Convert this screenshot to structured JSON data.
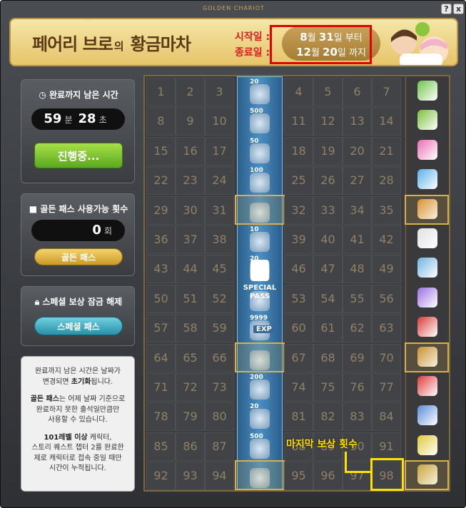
{
  "window": {
    "title": "GOLDEN CHARIOT",
    "help_label": "?",
    "close_label": "x"
  },
  "header": {
    "title_main": "페어리 브로",
    "title_particle": "의",
    "title_end": "황금마차",
    "start_label": "시작일 :",
    "end_label": "종료일 :",
    "start_month": "8",
    "start_month_unit": "월",
    "start_day": "31",
    "start_day_unit": "일 부터",
    "end_month": "12",
    "end_month_unit": "월",
    "end_day": "20",
    "end_day_unit": "일 까지"
  },
  "timer": {
    "title": "완료까지 남은 시간",
    "minutes": "59",
    "min_unit": "분",
    "seconds": "28",
    "sec_unit": "초",
    "button": "진행중..."
  },
  "golden_pass": {
    "title": "골든 패스 사용가능 횟수",
    "count": "0",
    "count_unit": "회",
    "button": "골든 패스"
  },
  "special": {
    "title": "스페셜 보상 잠금 해제",
    "button": "스페셜 패스"
  },
  "info": {
    "p1a": "완료까지 남은 시간은 날짜가",
    "p1b": "변경되면",
    "p1c": "초기화",
    "p1d": "됩니다.",
    "p2a": "골든 패스",
    "p2b": "는 어제 날짜 기준으로",
    "p2c": "완료하지 못한 출석일만큼만",
    "p2d": "사용할 수 있습니다.",
    "p3a": "101레벨 이상",
    "p3b": " 캐릭터,",
    "p3c": "스토리 퀘스트 챕터 2를 완료한",
    "p3d": "제로 캐릭터로 접속 중일 때만",
    "p3e": "시간이 누적됩니다."
  },
  "grid": {
    "rows": [
      [
        1,
        2,
        3,
        4,
        5,
        6,
        7
      ],
      [
        8,
        9,
        10,
        11,
        12,
        13,
        14
      ],
      [
        15,
        16,
        17,
        18,
        19,
        20,
        21
      ],
      [
        22,
        23,
        24,
        25,
        26,
        27,
        28
      ],
      [
        29,
        30,
        31,
        32,
        33,
        34,
        35
      ],
      [
        36,
        37,
        38,
        39,
        40,
        41,
        42
      ],
      [
        43,
        44,
        45,
        46,
        47,
        48,
        49
      ],
      [
        50,
        51,
        52,
        53,
        54,
        55,
        56
      ],
      [
        57,
        58,
        59,
        60,
        61,
        62,
        63
      ],
      [
        64,
        65,
        66,
        67,
        68,
        69,
        70
      ],
      [
        71,
        72,
        73,
        74,
        75,
        76,
        77
      ],
      [
        78,
        79,
        80,
        81,
        82,
        83,
        84
      ],
      [
        85,
        86,
        87,
        88,
        89,
        90,
        91
      ],
      [
        92,
        93,
        94,
        95,
        96,
        97,
        98
      ]
    ],
    "special_counts": [
      "20",
      "500",
      "50",
      "100",
      "",
      "10",
      "20",
      "",
      "9999",
      "",
      "200",
      "20",
      "500",
      ""
    ],
    "special_pass_label": "SPECIAL PASS",
    "exp_label": "EXP",
    "highlight_rows": [
      4,
      9,
      13
    ]
  },
  "annotation": {
    "last_reward": "마지막 보상 횟수"
  },
  "colors": {
    "accent_red": "#e30000",
    "annotation_yellow": "#ffe100",
    "gold": "#d9b04a"
  }
}
